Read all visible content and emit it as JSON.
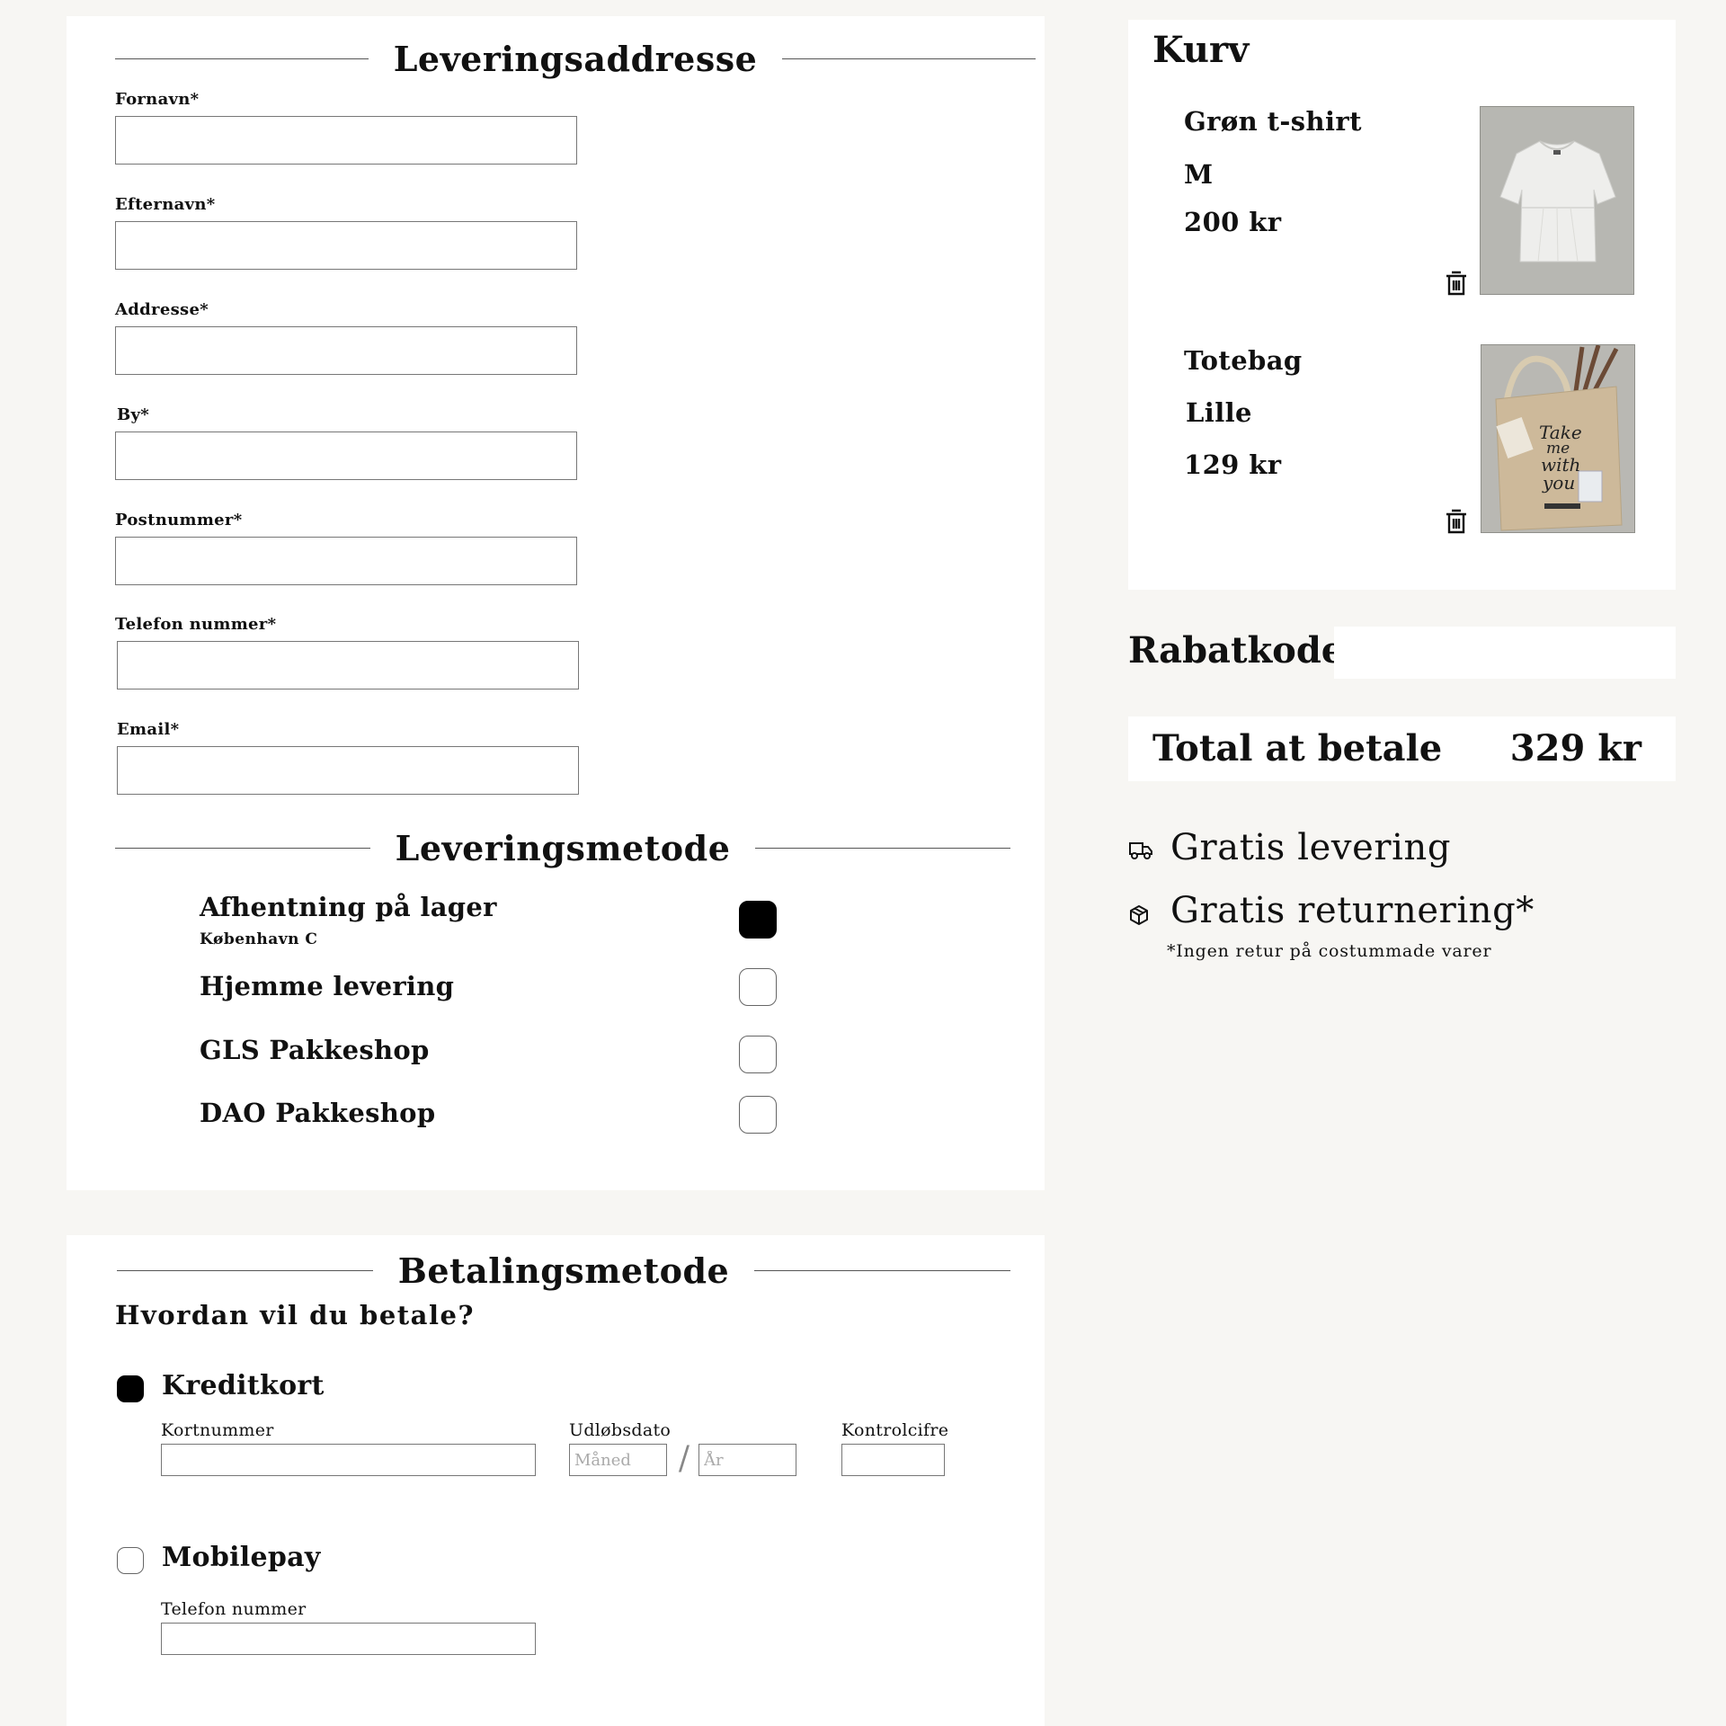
{
  "delivery_address": {
    "title": "Leveringsaddresse",
    "fields": [
      {
        "label": "Fornavn*",
        "value": ""
      },
      {
        "label": "Efternavn*",
        "value": ""
      },
      {
        "label": "Addresse*",
        "value": ""
      },
      {
        "label": "By*",
        "value": ""
      },
      {
        "label": "Postnummer*",
        "value": ""
      },
      {
        "label": "Telefon nummer*",
        "value": ""
      },
      {
        "label": "Email*",
        "value": ""
      }
    ]
  },
  "delivery_method": {
    "title": "Leveringsmetode",
    "options": [
      {
        "label": "Afhentning på lager",
        "sub": "København C",
        "checked": true
      },
      {
        "label": "Hjemme levering",
        "checked": false
      },
      {
        "label": "GLS Pakkeshop",
        "checked": false
      },
      {
        "label": "DAO Pakkeshop",
        "checked": false
      }
    ]
  },
  "payment": {
    "title": "Betalingsmetode",
    "question": "Hvordan vil du betale?",
    "credit_card": {
      "label": "Kreditkort",
      "selected": true,
      "card_number_label": "Kortnummer",
      "expiry_label": "Udløbsdato",
      "month_placeholder": "Måned",
      "separator": "/",
      "year_placeholder": "År",
      "cvc_label": "Kontrolcifre"
    },
    "mobilepay": {
      "label": "Mobilepay",
      "selected": false,
      "phone_label": "Telefon nummer"
    }
  },
  "cart": {
    "title": "Kurv",
    "items": [
      {
        "name": "Grøn t-shirt",
        "size": "M",
        "price": "200 kr",
        "image": "white-tshirt"
      },
      {
        "name": "Totebag",
        "size": "Lille",
        "price": "129 kr",
        "image": "tote-bag",
        "bag_print": [
          "Take",
          "me",
          "with",
          "you"
        ]
      }
    ]
  },
  "discount": {
    "label": "Rabatkode",
    "value": ""
  },
  "total": {
    "label": "Total at betale",
    "amount": "329 kr"
  },
  "perks": [
    {
      "icon": "truck-icon",
      "text": "Gratis levering"
    },
    {
      "icon": "box-icon",
      "text": "Gratis returnering*"
    }
  ],
  "perk_note": "*Ingen retur på costummade varer",
  "colors": {
    "background": "#f7f6f3",
    "panel": "#ffffff",
    "accent": "#000000"
  }
}
